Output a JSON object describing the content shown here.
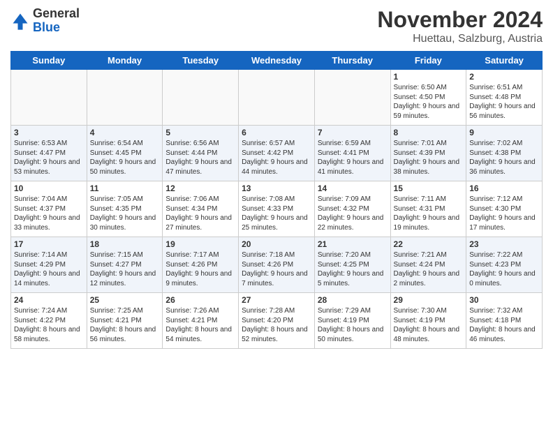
{
  "header": {
    "logo_general": "General",
    "logo_blue": "Blue",
    "month_title": "November 2024",
    "location": "Huettau, Salzburg, Austria"
  },
  "days_of_week": [
    "Sunday",
    "Monday",
    "Tuesday",
    "Wednesday",
    "Thursday",
    "Friday",
    "Saturday"
  ],
  "weeks": [
    [
      {
        "day": "",
        "info": "",
        "empty": true
      },
      {
        "day": "",
        "info": "",
        "empty": true
      },
      {
        "day": "",
        "info": "",
        "empty": true
      },
      {
        "day": "",
        "info": "",
        "empty": true
      },
      {
        "day": "",
        "info": "",
        "empty": true
      },
      {
        "day": "1",
        "info": "Sunrise: 6:50 AM\nSunset: 4:50 PM\nDaylight: 9 hours and 59 minutes."
      },
      {
        "day": "2",
        "info": "Sunrise: 6:51 AM\nSunset: 4:48 PM\nDaylight: 9 hours and 56 minutes."
      }
    ],
    [
      {
        "day": "3",
        "info": "Sunrise: 6:53 AM\nSunset: 4:47 PM\nDaylight: 9 hours and 53 minutes."
      },
      {
        "day": "4",
        "info": "Sunrise: 6:54 AM\nSunset: 4:45 PM\nDaylight: 9 hours and 50 minutes."
      },
      {
        "day": "5",
        "info": "Sunrise: 6:56 AM\nSunset: 4:44 PM\nDaylight: 9 hours and 47 minutes."
      },
      {
        "day": "6",
        "info": "Sunrise: 6:57 AM\nSunset: 4:42 PM\nDaylight: 9 hours and 44 minutes."
      },
      {
        "day": "7",
        "info": "Sunrise: 6:59 AM\nSunset: 4:41 PM\nDaylight: 9 hours and 41 minutes."
      },
      {
        "day": "8",
        "info": "Sunrise: 7:01 AM\nSunset: 4:39 PM\nDaylight: 9 hours and 38 minutes."
      },
      {
        "day": "9",
        "info": "Sunrise: 7:02 AM\nSunset: 4:38 PM\nDaylight: 9 hours and 36 minutes."
      }
    ],
    [
      {
        "day": "10",
        "info": "Sunrise: 7:04 AM\nSunset: 4:37 PM\nDaylight: 9 hours and 33 minutes."
      },
      {
        "day": "11",
        "info": "Sunrise: 7:05 AM\nSunset: 4:35 PM\nDaylight: 9 hours and 30 minutes."
      },
      {
        "day": "12",
        "info": "Sunrise: 7:06 AM\nSunset: 4:34 PM\nDaylight: 9 hours and 27 minutes."
      },
      {
        "day": "13",
        "info": "Sunrise: 7:08 AM\nSunset: 4:33 PM\nDaylight: 9 hours and 25 minutes."
      },
      {
        "day": "14",
        "info": "Sunrise: 7:09 AM\nSunset: 4:32 PM\nDaylight: 9 hours and 22 minutes."
      },
      {
        "day": "15",
        "info": "Sunrise: 7:11 AM\nSunset: 4:31 PM\nDaylight: 9 hours and 19 minutes."
      },
      {
        "day": "16",
        "info": "Sunrise: 7:12 AM\nSunset: 4:30 PM\nDaylight: 9 hours and 17 minutes."
      }
    ],
    [
      {
        "day": "17",
        "info": "Sunrise: 7:14 AM\nSunset: 4:29 PM\nDaylight: 9 hours and 14 minutes."
      },
      {
        "day": "18",
        "info": "Sunrise: 7:15 AM\nSunset: 4:27 PM\nDaylight: 9 hours and 12 minutes."
      },
      {
        "day": "19",
        "info": "Sunrise: 7:17 AM\nSunset: 4:26 PM\nDaylight: 9 hours and 9 minutes."
      },
      {
        "day": "20",
        "info": "Sunrise: 7:18 AM\nSunset: 4:26 PM\nDaylight: 9 hours and 7 minutes."
      },
      {
        "day": "21",
        "info": "Sunrise: 7:20 AM\nSunset: 4:25 PM\nDaylight: 9 hours and 5 minutes."
      },
      {
        "day": "22",
        "info": "Sunrise: 7:21 AM\nSunset: 4:24 PM\nDaylight: 9 hours and 2 minutes."
      },
      {
        "day": "23",
        "info": "Sunrise: 7:22 AM\nSunset: 4:23 PM\nDaylight: 9 hours and 0 minutes."
      }
    ],
    [
      {
        "day": "24",
        "info": "Sunrise: 7:24 AM\nSunset: 4:22 PM\nDaylight: 8 hours and 58 minutes."
      },
      {
        "day": "25",
        "info": "Sunrise: 7:25 AM\nSunset: 4:21 PM\nDaylight: 8 hours and 56 minutes."
      },
      {
        "day": "26",
        "info": "Sunrise: 7:26 AM\nSunset: 4:21 PM\nDaylight: 8 hours and 54 minutes."
      },
      {
        "day": "27",
        "info": "Sunrise: 7:28 AM\nSunset: 4:20 PM\nDaylight: 8 hours and 52 minutes."
      },
      {
        "day": "28",
        "info": "Sunrise: 7:29 AM\nSunset: 4:19 PM\nDaylight: 8 hours and 50 minutes."
      },
      {
        "day": "29",
        "info": "Sunrise: 7:30 AM\nSunset: 4:19 PM\nDaylight: 8 hours and 48 minutes."
      },
      {
        "day": "30",
        "info": "Sunrise: 7:32 AM\nSunset: 4:18 PM\nDaylight: 8 hours and 46 minutes."
      }
    ]
  ]
}
